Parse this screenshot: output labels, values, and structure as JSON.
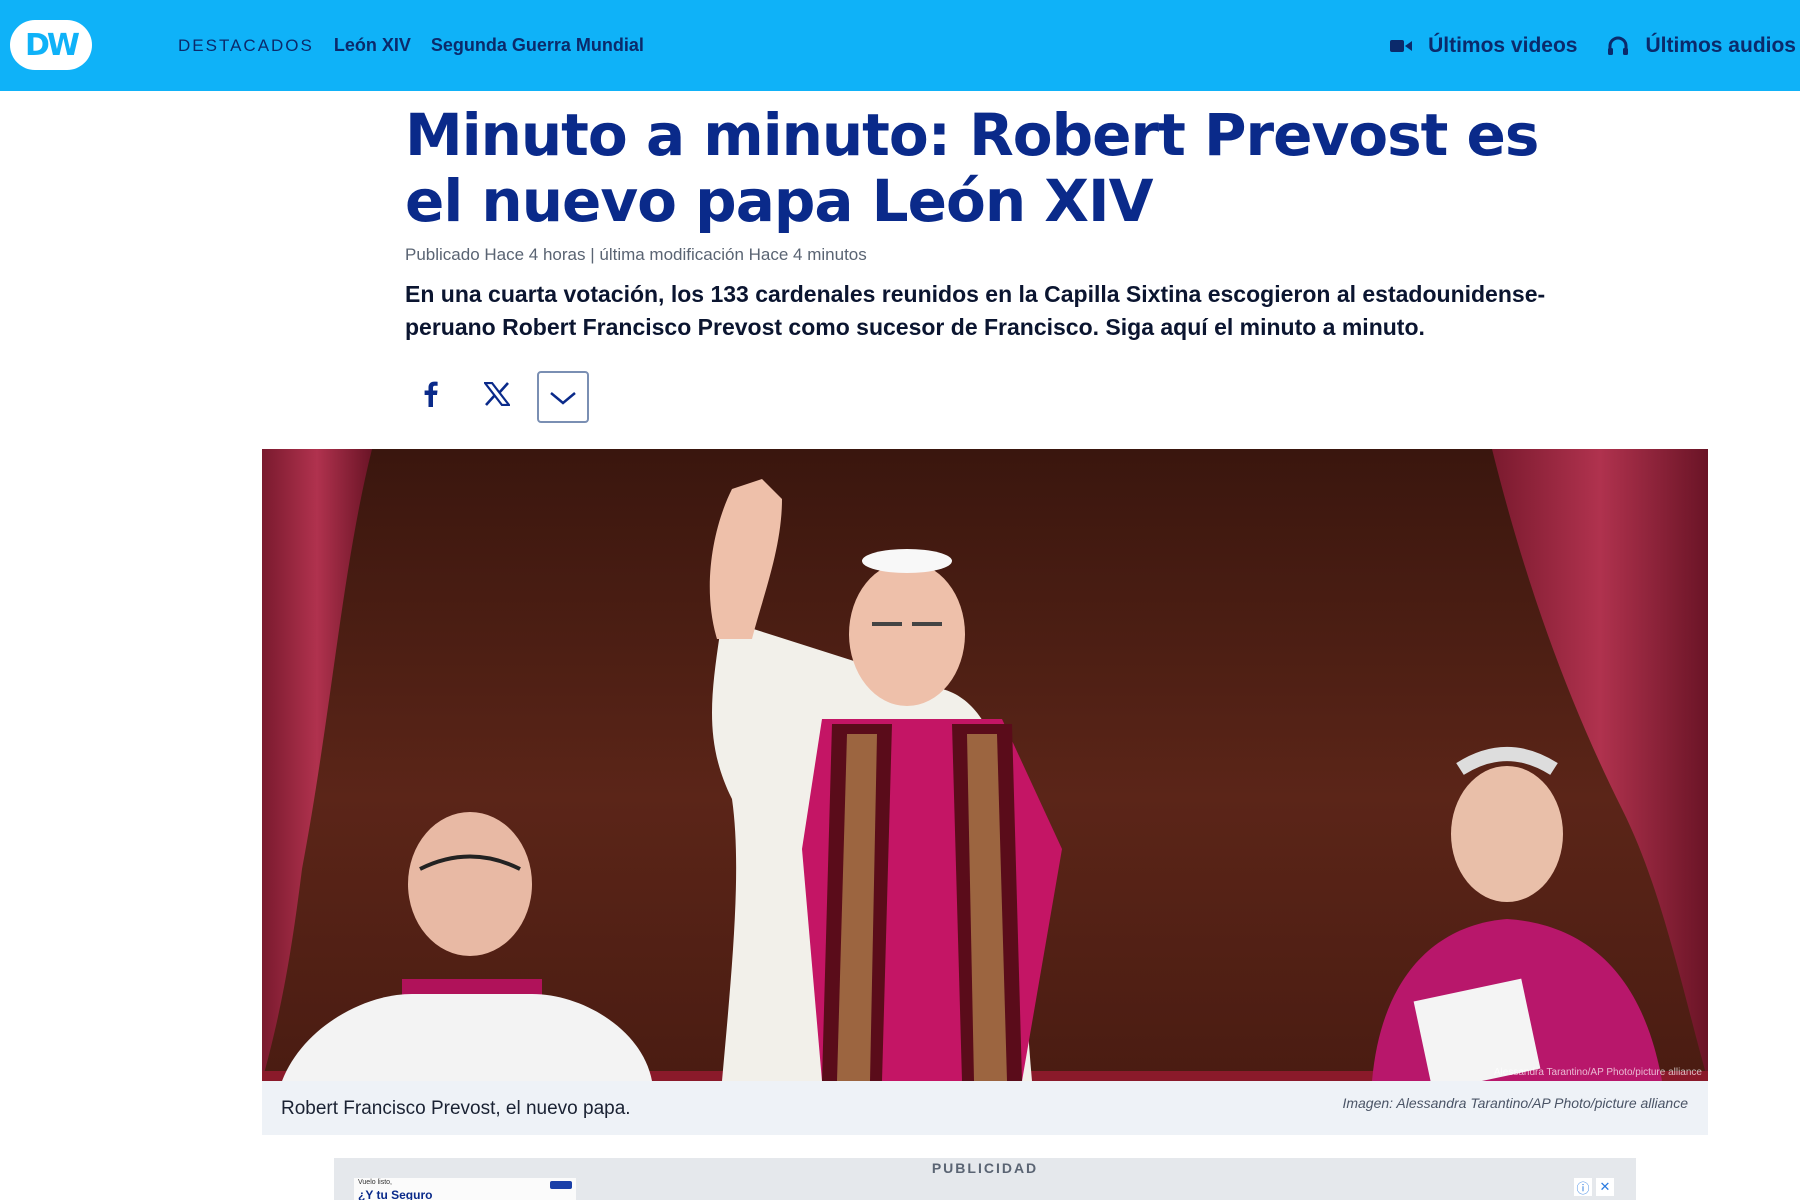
{
  "header": {
    "logo": "DW",
    "section_label": "DESTACADOS",
    "nav_links": [
      "León XIV",
      "Segunda Guerra Mundial"
    ],
    "videos_label": "Últimos videos",
    "videos_icon": "video-camera-icon",
    "audios_label": "Últimos audios",
    "audios_icon": "headphones-icon",
    "bar_color": "#0fb2f8",
    "link_color": "#0b2a6b"
  },
  "article": {
    "title": "Minuto a minuto: Robert Prevost es el nuevo papa León XIV",
    "meta": "Publicado Hace 4 horas | última modificación Hace 4 minutos",
    "lead": "En una cuarta votación, los 133 cardenales reunidos en la Capilla Sixtina escogieron al estadounidense-peruano Robert Francisco Prevost como sucesor de Francisco. Siga aquí el minuto a minuto.",
    "title_color": "#0a2a8a"
  },
  "share": {
    "facebook_icon": "facebook-icon",
    "x_icon": "x-icon",
    "more_icon": "chevron-down-icon"
  },
  "image": {
    "caption": "Robert Francisco Prevost, el nuevo papa.",
    "credit": "Imagen: Alessandra Tarantino/AP Photo/picture alliance",
    "overlay_credit": "Alessandra Tarantino/AP Photo/picture alliance"
  },
  "ad": {
    "label": "PUBLICIDAD",
    "thumb_line1": "Vuelo listo,",
    "thumb_line2": "¿Y tu Seguro",
    "info_icon": "info-icon",
    "close_icon": "close-icon"
  }
}
